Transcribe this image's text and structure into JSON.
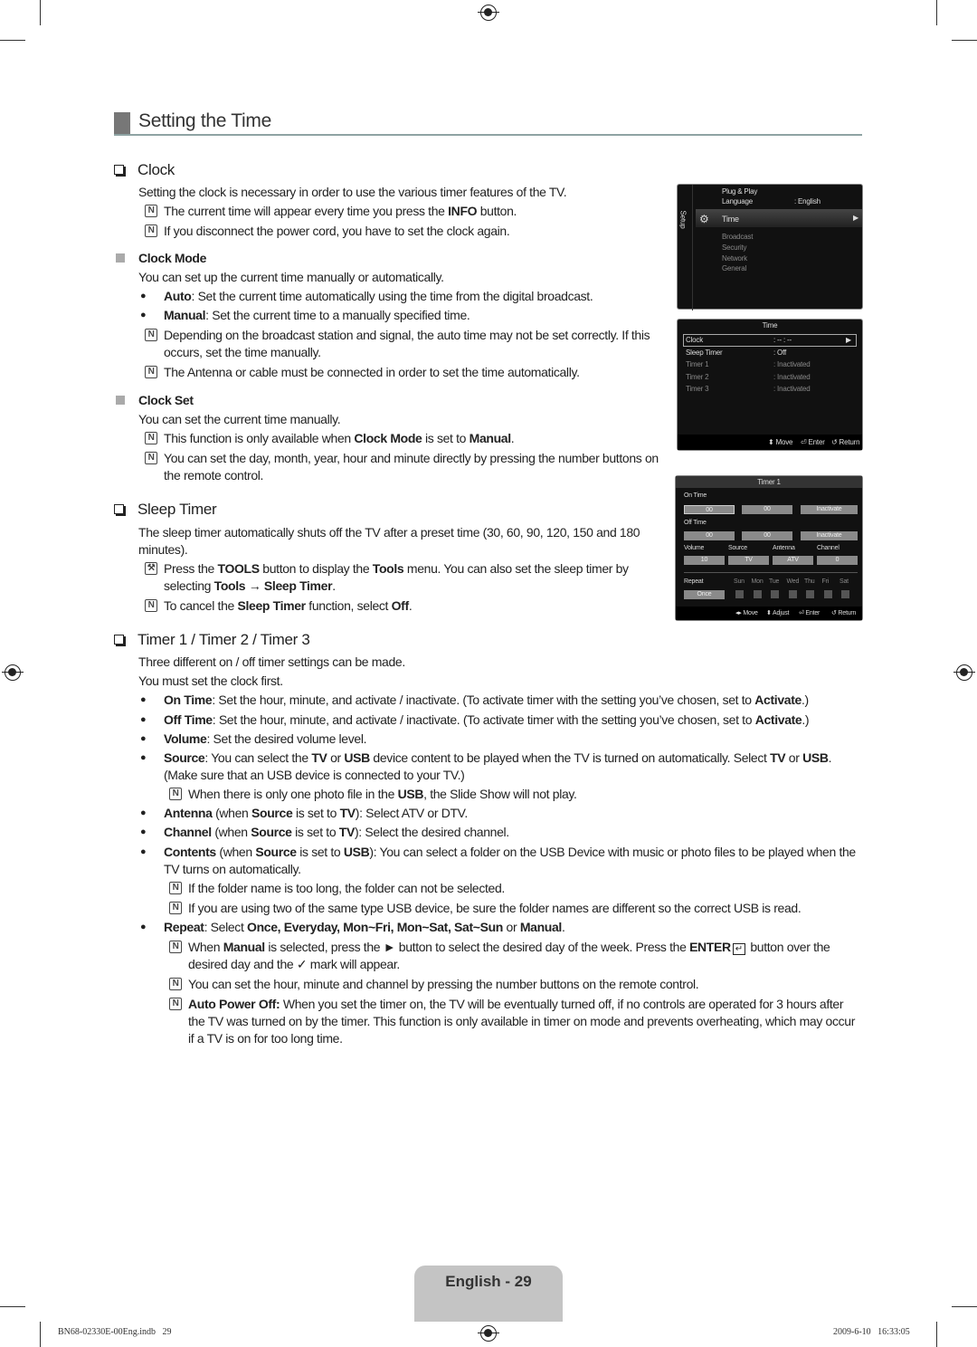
{
  "title": "Setting the Time",
  "colors": {
    "title_rule": "#8ea3a3",
    "page_tab": "#c4c4c4",
    "osd_bg": "#111111"
  },
  "icons": {
    "heading": "checkbox-bullet-icon",
    "subheading": "gray-square-icon",
    "note": "note-icon",
    "tools": "tools-icon",
    "bullet": "bullet-dot-icon"
  },
  "content": [
    {
      "k": "h2",
      "s": [
        {
          "t": "Clock"
        }
      ]
    },
    {
      "k": "p",
      "s": [
        {
          "t": "Setting the clock is necessary in order to use the various timer features of the TV."
        }
      ]
    },
    {
      "k": "note",
      "s": [
        {
          "t": "The current time will appear every time you press the "
        },
        {
          "t": "INFO",
          "b": true
        },
        {
          "t": " button."
        }
      ]
    },
    {
      "k": "note",
      "s": [
        {
          "t": "If you disconnect the power cord, you have to set the clock again."
        }
      ]
    },
    {
      "k": "h3",
      "s": [
        {
          "t": "Clock Mode"
        }
      ]
    },
    {
      "k": "p",
      "s": [
        {
          "t": "You can set up the current time manually or automatically."
        }
      ]
    },
    {
      "k": "bullet",
      "s": [
        {
          "t": "Auto",
          "b": true
        },
        {
          "t": ": Set the current time automatically using the time from the digital broadcast."
        }
      ]
    },
    {
      "k": "bullet",
      "s": [
        {
          "t": "Manual",
          "b": true
        },
        {
          "t": ": Set the current time to a manually specified time."
        }
      ]
    },
    {
      "k": "note",
      "s": [
        {
          "t": "Depending on the broadcast station and signal, the auto time may not be set correctly. If this occurs, set the time manually."
        }
      ]
    },
    {
      "k": "note",
      "s": [
        {
          "t": "The Antenna or cable must be connected in order to set the time automatically."
        }
      ]
    },
    {
      "k": "h3",
      "s": [
        {
          "t": "Clock Set"
        }
      ]
    },
    {
      "k": "p",
      "s": [
        {
          "t": "You can set the current time manually."
        }
      ]
    },
    {
      "k": "note",
      "s": [
        {
          "t": "This function is only available when "
        },
        {
          "t": "Clock Mode",
          "b": true
        },
        {
          "t": " is set to "
        },
        {
          "t": "Manual",
          "b": true
        },
        {
          "t": "."
        }
      ]
    },
    {
      "k": "note",
      "s": [
        {
          "t": "You can set the day, month, year, hour and minute directly by pressing the number buttons on the remote control."
        }
      ]
    },
    {
      "k": "h2",
      "s": [
        {
          "t": "Sleep Timer"
        }
      ]
    },
    {
      "k": "p",
      "s": [
        {
          "t": "The sleep timer automatically shuts off the TV after a preset time (30, 60, 90, 120, 150 and 180 minutes)."
        }
      ]
    },
    {
      "k": "tools",
      "s": [
        {
          "t": "Press the "
        },
        {
          "t": "TOOLS",
          "b": true
        },
        {
          "t": " button to display the "
        },
        {
          "t": "Tools",
          "b": true
        },
        {
          "t": " menu. You can also set the sleep timer by selecting "
        },
        {
          "t": "Tools → Sleep Timer",
          "b": true
        },
        {
          "t": "."
        }
      ]
    },
    {
      "k": "note",
      "s": [
        {
          "t": "To cancel the "
        },
        {
          "t": "Sleep Timer",
          "b": true
        },
        {
          "t": " function, select "
        },
        {
          "t": "Off",
          "b": true
        },
        {
          "t": "."
        }
      ]
    },
    {
      "k": "h2",
      "s": [
        {
          "t": "Timer 1 / Timer 2 / Timer 3"
        }
      ]
    },
    {
      "k": "p",
      "s": [
        {
          "t": "Three different on / off timer settings can be made."
        }
      ]
    },
    {
      "k": "p",
      "s": [
        {
          "t": "You must set the clock first."
        }
      ]
    },
    {
      "k": "bullet",
      "s": [
        {
          "t": "On Time",
          "b": true
        },
        {
          "t": ": Set the hour, minute, and activate / inactivate. (To activate timer with the setting you’ve chosen, set to "
        },
        {
          "t": "Activate",
          "b": true
        },
        {
          "t": ".)"
        }
      ]
    },
    {
      "k": "bullet",
      "s": [
        {
          "t": "Off Time",
          "b": true
        },
        {
          "t": ": Set the hour, minute, and activate / inactivate. (To activate timer with the setting you’ve chosen, set to "
        },
        {
          "t": "Activate",
          "b": true
        },
        {
          "t": ".)"
        }
      ]
    },
    {
      "k": "bullet",
      "s": [
        {
          "t": "Volume",
          "b": true
        },
        {
          "t": ": Set the desired volume level."
        }
      ]
    },
    {
      "k": "bullet",
      "s": [
        {
          "t": "Source",
          "b": true
        },
        {
          "t": ": You can select the "
        },
        {
          "t": "TV",
          "b": true
        },
        {
          "t": " or "
        },
        {
          "t": "USB",
          "b": true
        },
        {
          "t": " device content to be played when the TV is turned on automatically. Select "
        },
        {
          "t": "TV",
          "b": true
        },
        {
          "t": " or "
        },
        {
          "t": "USB",
          "b": true
        },
        {
          "t": ". (Make sure that an USB device is connected to your TV.)"
        }
      ]
    },
    {
      "k": "subnote",
      "s": [
        {
          "t": "When there is only one photo file in the "
        },
        {
          "t": "USB",
          "b": true
        },
        {
          "t": ", the Slide Show will not play."
        }
      ]
    },
    {
      "k": "bullet",
      "s": [
        {
          "t": "Antenna",
          "b": true
        },
        {
          "t": " (when "
        },
        {
          "t": "Source",
          "b": true
        },
        {
          "t": " is set to "
        },
        {
          "t": "TV",
          "b": true
        },
        {
          "t": "): Select ATV or DTV."
        }
      ]
    },
    {
      "k": "bullet",
      "s": [
        {
          "t": "Channel",
          "b": true
        },
        {
          "t": " (when "
        },
        {
          "t": "Source",
          "b": true
        },
        {
          "t": " is set to "
        },
        {
          "t": "TV",
          "b": true
        },
        {
          "t": "): Select the desired channel."
        }
      ]
    },
    {
      "k": "bullet",
      "s": [
        {
          "t": "Contents",
          "b": true
        },
        {
          "t": " (when "
        },
        {
          "t": "Source",
          "b": true
        },
        {
          "t": " is set to "
        },
        {
          "t": "USB",
          "b": true
        },
        {
          "t": "): You can select a folder on the USB Device with music or photo files to be played when the TV turns on automatically."
        }
      ]
    },
    {
      "k": "subnote",
      "s": [
        {
          "t": "If the folder name is too long, the folder can not be selected."
        }
      ]
    },
    {
      "k": "subnote",
      "s": [
        {
          "t": "If you are using two of the same type USB device, be sure the folder names are different so the correct USB is read."
        }
      ]
    },
    {
      "k": "bullet",
      "s": [
        {
          "t": "Repeat",
          "b": true
        },
        {
          "t": ": Select "
        },
        {
          "t": "Once, Everyday, Mon~Fri, Mon~Sat, Sat~Sun",
          "b": true
        },
        {
          "t": " or "
        },
        {
          "t": "Manual",
          "b": true
        },
        {
          "t": "."
        }
      ]
    },
    {
      "k": "subnote",
      "s": [
        {
          "t": "When "
        },
        {
          "t": "Manual",
          "b": true
        },
        {
          "t": " is selected, press the ► button to select the desired day of the week. Press the "
        },
        {
          "t": "ENTER",
          "b": true
        },
        {
          "i": "enter-icon",
          "t": "↵"
        },
        {
          "t": " button over the desired day and the "
        },
        {
          "i": "check-icon",
          "t": "✓"
        },
        {
          "t": " mark will appear."
        }
      ]
    },
    {
      "k": "subnote",
      "s": [
        {
          "t": "You can set the hour, minute and channel by pressing the number buttons on the remote control."
        }
      ]
    },
    {
      "k": "subnote",
      "s": [
        {
          "t": "Auto Power Off:",
          "b": true
        },
        {
          "t": " When you set the timer on, the TV will be eventually turned off, if no controls are operated for 3 hours after the TV was turned on by the timer. This function is only available in timer on mode and prevents overheating, which may occur if a TV is on for too long time."
        }
      ]
    }
  ],
  "setup_menu": {
    "side_label": "Setup",
    "items": [
      "Plug & Play",
      "Language",
      "Time",
      "Broadcast",
      "Security",
      "Network",
      "General"
    ],
    "language_value": ": English"
  },
  "time_menu": {
    "title": "Time",
    "rows": [
      {
        "label": "Clock",
        "value": ": -- : --"
      },
      {
        "label": "Sleep Timer",
        "value": ": Off"
      },
      {
        "label": "Timer 1",
        "value": ": Inactivated"
      },
      {
        "label": "Timer 2",
        "value": ": Inactivated"
      },
      {
        "label": "Timer 3",
        "value": ": Inactivated"
      }
    ],
    "footer": [
      "Move",
      "Enter",
      "Return"
    ]
  },
  "timer_menu": {
    "title": "Timer 1",
    "on_time_label": "On Time",
    "on_time": [
      "00",
      "00",
      "Inactivate"
    ],
    "off_time_label": "Off Time",
    "off_time": [
      "00",
      "00",
      "Inactivate"
    ],
    "fields": [
      {
        "label": "Volume",
        "value": "10"
      },
      {
        "label": "Source",
        "value": "TV"
      },
      {
        "label": "Antenna",
        "value": "ATV"
      },
      {
        "label": "Channel",
        "value": "0"
      }
    ],
    "repeat_label": "Repeat",
    "repeat_value": "Once",
    "days": [
      "Sun",
      "Mon",
      "Tue",
      "Wed",
      "Thu",
      "Fri",
      "Sat"
    ],
    "footer": [
      "Move",
      "Adjust",
      "Enter",
      "Return"
    ]
  },
  "page_label": "English - 29",
  "footer_left": "BN68-02330E-00Eng.indb   29",
  "footer_right": "2009-6-10   16:33:05"
}
